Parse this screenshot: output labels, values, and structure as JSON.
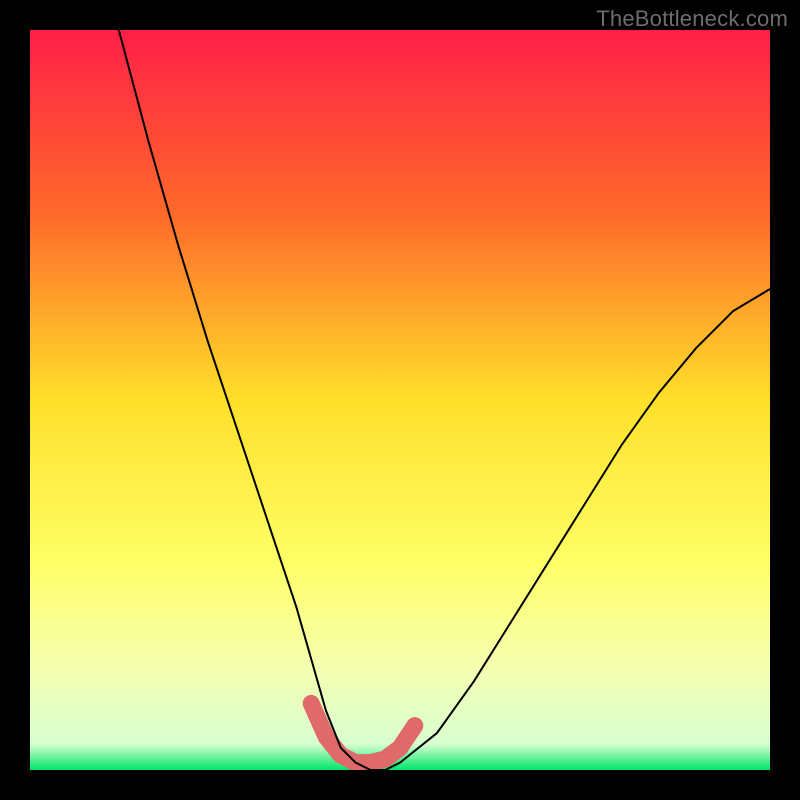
{
  "watermark": {
    "text": "TheBottleneck.com"
  },
  "colors": {
    "frame": "#000000",
    "gradient_stops": [
      {
        "offset": 0.0,
        "color": "#ff1f47"
      },
      {
        "offset": 0.25,
        "color": "#ff6a2a"
      },
      {
        "offset": 0.5,
        "color": "#ffe02a"
      },
      {
        "offset": 0.72,
        "color": "#ffff66"
      },
      {
        "offset": 0.86,
        "color": "#f5ffb0"
      },
      {
        "offset": 0.965,
        "color": "#d8ffd0"
      },
      {
        "offset": 1.0,
        "color": "#00e66a"
      }
    ],
    "curve": "#000000",
    "highlight": "#e06a6a"
  },
  "chart_data": {
    "type": "line",
    "title": "",
    "xlabel": "",
    "ylabel": "",
    "xlim": [
      0,
      100
    ],
    "ylim": [
      0,
      100
    ],
    "legend": false,
    "grid": false,
    "series": [
      {
        "name": "bottleneck-curve",
        "x": [
          12,
          16,
          20,
          24,
          28,
          32,
          36,
          38,
          40,
          42,
          44,
          46,
          48,
          50,
          55,
          60,
          65,
          70,
          75,
          80,
          85,
          90,
          95,
          100
        ],
        "y": [
          100,
          85,
          71,
          58,
          46,
          34,
          22,
          15,
          8,
          3,
          1,
          0,
          0,
          1,
          5,
          12,
          20,
          28,
          36,
          44,
          51,
          57,
          62,
          65
        ]
      },
      {
        "name": "highlight-band",
        "x": [
          38,
          40,
          42,
          44,
          46,
          48,
          50,
          52
        ],
        "y": [
          9,
          4.5,
          2,
          1,
          1,
          1.5,
          3,
          6
        ]
      }
    ],
    "annotations": []
  }
}
